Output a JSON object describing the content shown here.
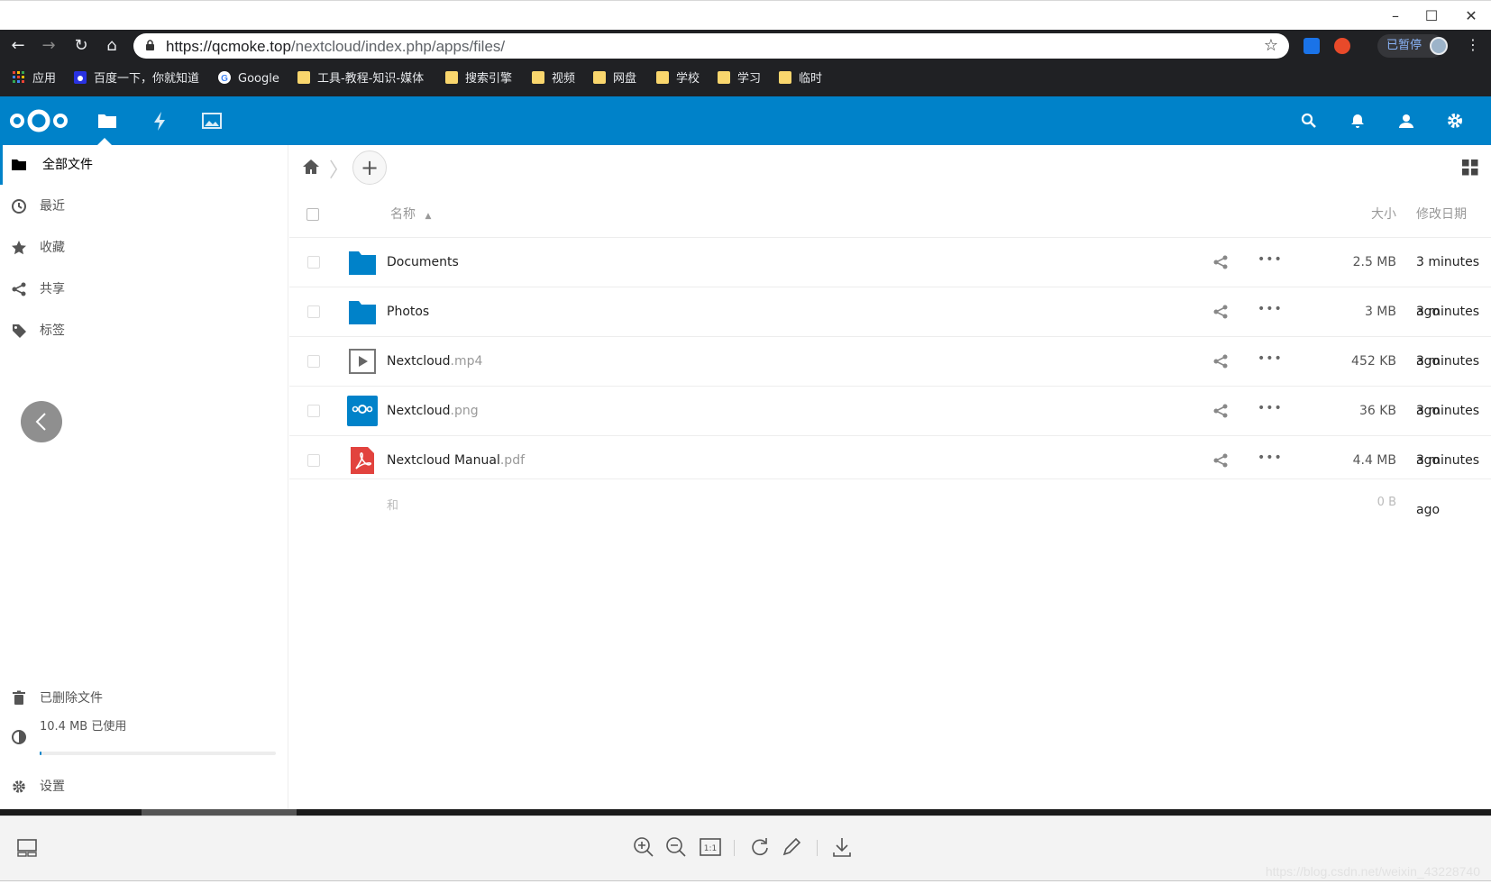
{
  "browser": {
    "url_main": "https://qcmoke.top",
    "url_path": "/nextcloud/index.php/apps/files/",
    "paused_label": "已暂停",
    "bookmarks": [
      {
        "label": "应用",
        "icon": "apps-grid-icon"
      },
      {
        "label": "百度一下，你就知道",
        "icon": "baidu-icon"
      },
      {
        "label": "Google",
        "icon": "google-icon"
      },
      {
        "label": "工具-教程-知识-媒体",
        "icon": "folder-icon"
      },
      {
        "label": "搜索引擎",
        "icon": "folder-icon"
      },
      {
        "label": "视频",
        "icon": "folder-icon"
      },
      {
        "label": "网盘",
        "icon": "folder-icon"
      },
      {
        "label": "学校",
        "icon": "folder-icon"
      },
      {
        "label": "学习",
        "icon": "folder-icon"
      },
      {
        "label": "临时",
        "icon": "folder-icon"
      }
    ]
  },
  "sidebar": {
    "items": [
      {
        "label": "全部文件",
        "icon": "folder-icon"
      },
      {
        "label": "最近",
        "icon": "clock-icon"
      },
      {
        "label": "收藏",
        "icon": "star-icon"
      },
      {
        "label": "共享",
        "icon": "share-icon"
      },
      {
        "label": "标签",
        "icon": "tag-icon"
      }
    ],
    "deleted_label": "已删除文件",
    "quota_label": "10.4 MB 已使用",
    "quota_fraction": 0.005,
    "settings_label": "设置"
  },
  "table": {
    "header_name": "名称",
    "header_size": "大小",
    "header_modified": "修改日期",
    "rows": [
      {
        "name": "Documents",
        "ext": "",
        "type": "folder",
        "size": "2.5 MB",
        "modified": "3 minutes ago"
      },
      {
        "name": "Photos",
        "ext": "",
        "type": "folder",
        "size": "3 MB",
        "modified": "3 minutes ago"
      },
      {
        "name": "Nextcloud",
        "ext": ".mp4",
        "type": "video",
        "size": "452 KB",
        "modified": "3 minutes ago"
      },
      {
        "name": "Nextcloud",
        "ext": ".png",
        "type": "image",
        "size": "36 KB",
        "modified": "3 minutes ago"
      },
      {
        "name": "Nextcloud Manual",
        "ext": ".pdf",
        "type": "pdf",
        "size": "4.4 MB",
        "modified": "3 minutes ago"
      }
    ],
    "summary_text": "和",
    "summary_size": "0 B"
  },
  "watermark": "https://blog.csdn.net/weixin_43228740",
  "colors": {
    "brand": "#0082c9",
    "chrome_dark": "#202124",
    "pdf_red": "#e2433e"
  }
}
